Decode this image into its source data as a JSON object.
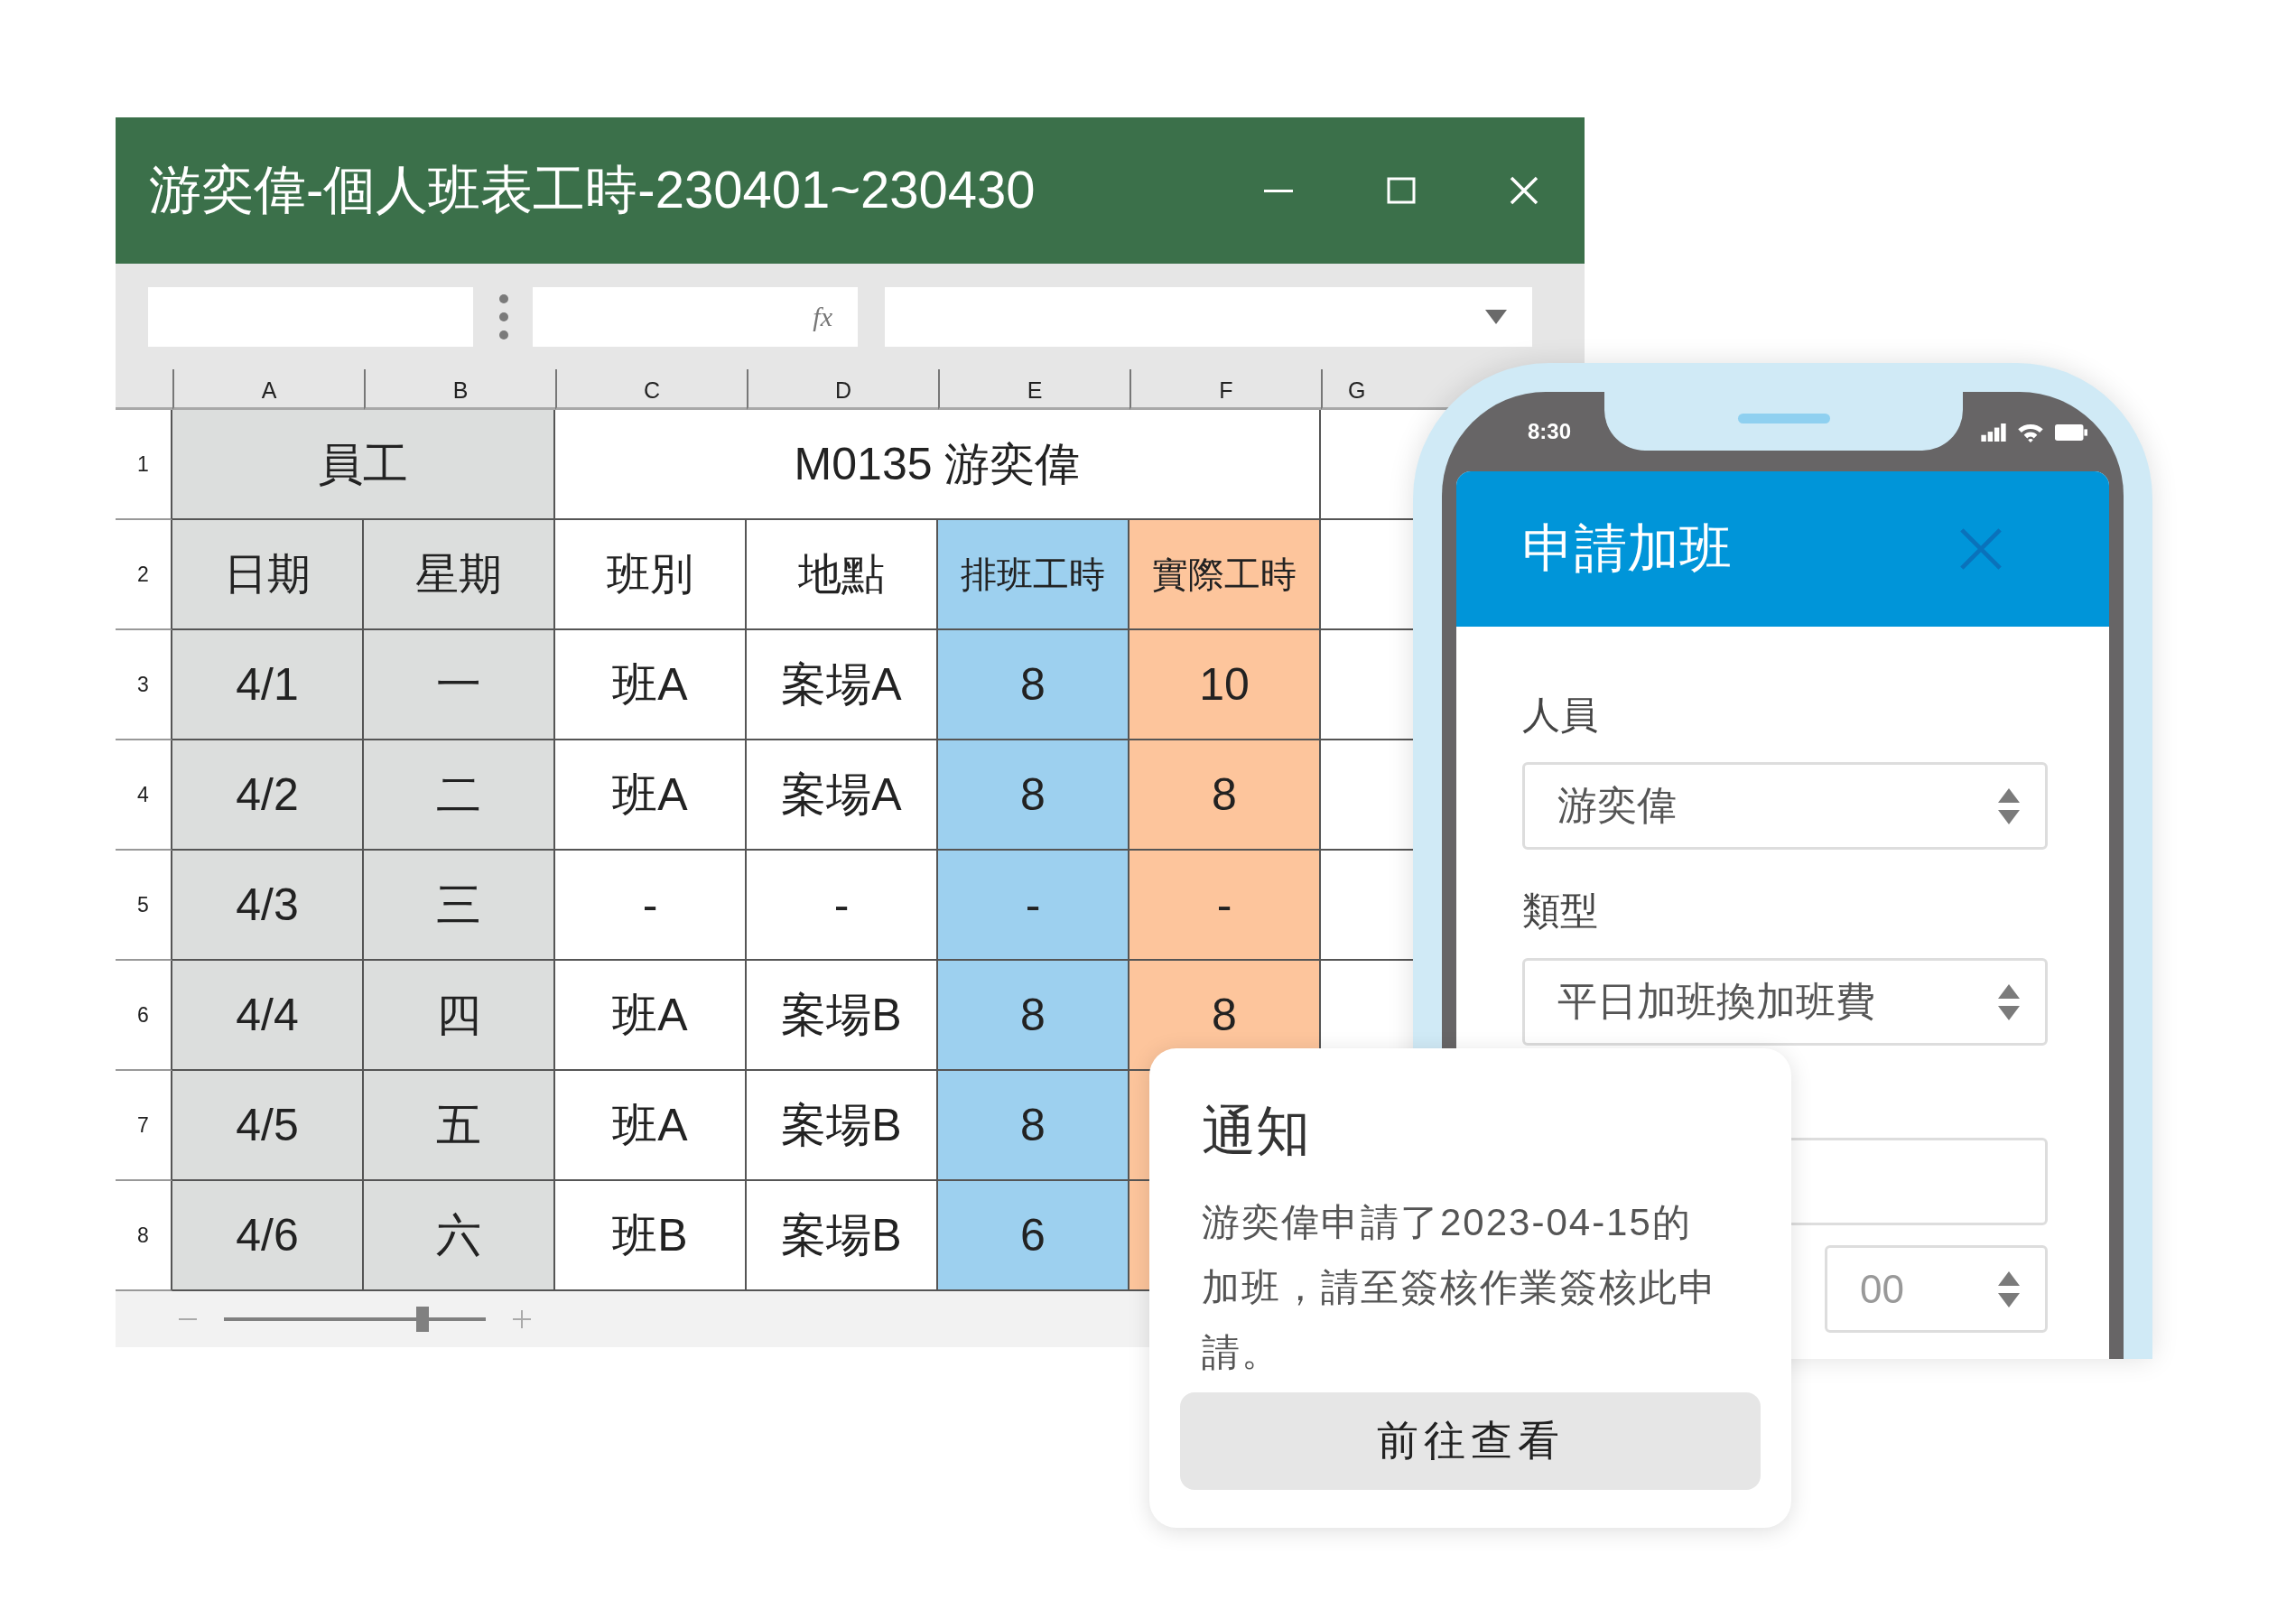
{
  "window": {
    "title": "游奕偉-個人班表工時-230401~230430"
  },
  "toolbar": {
    "function_label": "fx"
  },
  "columns": [
    {
      "letter": "A",
      "color": "#dcdedd"
    },
    {
      "letter": "B",
      "color": "#dcdedd"
    },
    {
      "letter": "C"
    },
    {
      "letter": "D"
    },
    {
      "letter": "E",
      "color": "#9dd0ef"
    },
    {
      "letter": "F",
      "color": "#fdc59c"
    },
    {
      "letter": "G"
    }
  ],
  "header_row": {
    "number": "1",
    "employee_label": "員工",
    "employee": "M0135 游奕偉"
  },
  "rows": [
    {
      "number": "2",
      "kind": "header",
      "cells": [
        "日期",
        "星期",
        "班別",
        "地點",
        "排班工時",
        "實際工時"
      ]
    },
    {
      "number": "3",
      "kind": "data",
      "cells": [
        "4/1",
        "一",
        "班A",
        "案場A",
        "8",
        "10"
      ]
    },
    {
      "number": "4",
      "kind": "data",
      "cells": [
        "4/2",
        "二",
        "班A",
        "案場A",
        "8",
        "8"
      ]
    },
    {
      "number": "5",
      "kind": "data",
      "cells": [
        "4/3",
        "三",
        "-",
        "-",
        "-",
        "-"
      ]
    },
    {
      "number": "6",
      "kind": "data",
      "cells": [
        "4/4",
        "四",
        "班A",
        "案場B",
        "8",
        "8"
      ]
    },
    {
      "number": "7",
      "kind": "data",
      "cells": [
        "4/5",
        "五",
        "班A",
        "案場B",
        "8"
      ]
    },
    {
      "number": "8",
      "kind": "data",
      "cells": [
        "4/6",
        "六",
        "班B",
        "案場B",
        "6"
      ]
    }
  ],
  "zoom": {
    "level": 0.76
  },
  "phone": {
    "status_bar": {
      "time": "8:30"
    },
    "dialog": {
      "title": "申請加班",
      "fields": [
        {
          "kind": "select",
          "label": "人員",
          "value": "游奕偉"
        },
        {
          "kind": "select",
          "label": "類型",
          "value": "平日加班換加班費"
        },
        {
          "kind": "text"
        },
        {
          "kind": "spinner",
          "placeholder": "00"
        }
      ]
    }
  },
  "notification": {
    "title": "通知",
    "message": "游奕偉申請了2023-04-15的加班，請至簽核作業簽核此申請。",
    "button": "前往查看"
  }
}
